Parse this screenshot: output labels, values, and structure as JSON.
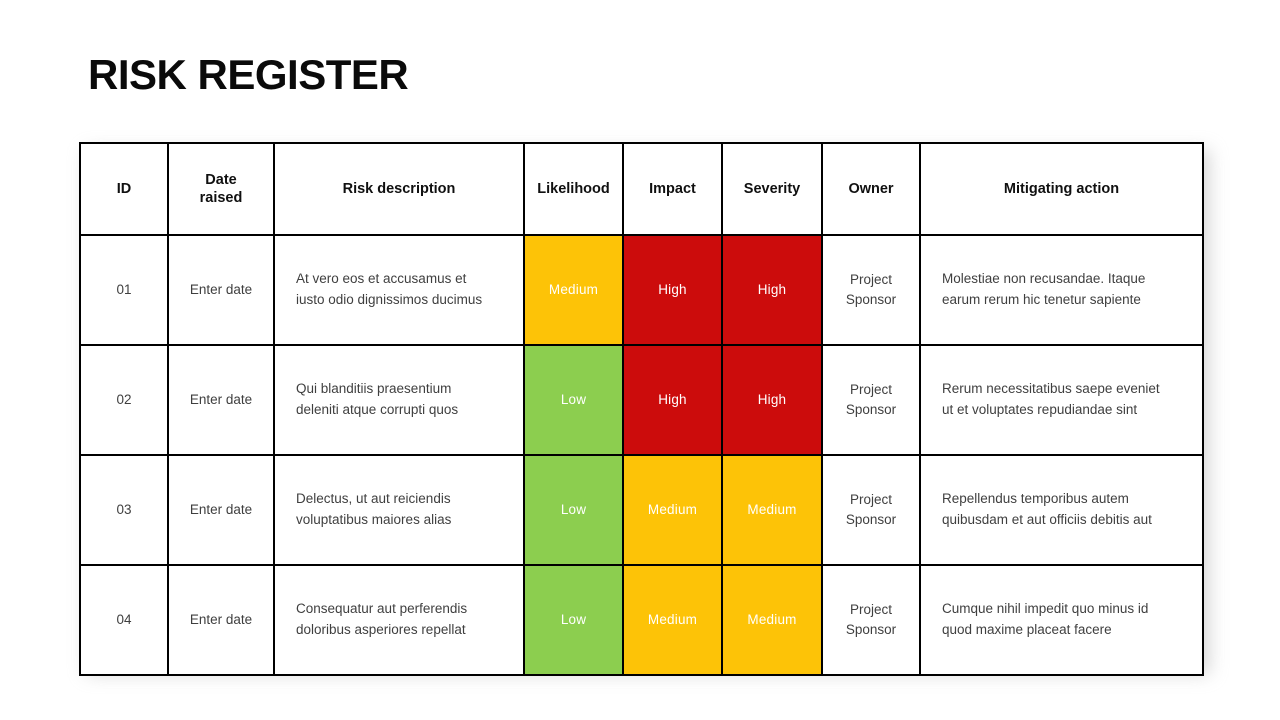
{
  "slide": {
    "title": "RISK REGISTER",
    "background_color": "#ffffff"
  },
  "colors": {
    "high": "#cc0c0c",
    "medium": "#fdc307",
    "low": "#8cce4f",
    "border": "#000000",
    "title_text": "#0a0a0a",
    "body_text": "#3f3f3f",
    "rating_text": "#ffffff"
  },
  "table": {
    "headers": [
      "ID",
      "Date\nraised",
      "Risk description",
      "Likelihood",
      "Impact",
      "Severity",
      "Owner",
      "Mitigating action"
    ],
    "header_labels": {
      "id": "ID",
      "date_raised_line1": "Date",
      "date_raised_line2": "raised",
      "risk_description": "Risk description",
      "likelihood": "Likelihood",
      "impact": "Impact",
      "severity": "Severity",
      "owner": "Owner",
      "mitigating_action": "Mitigating action"
    },
    "rows": [
      {
        "id": "01",
        "date_raised": "Enter date",
        "risk_description_line1": "At vero eos et accusamus et",
        "risk_description_line2": "iusto odio dignissimos ducimus",
        "likelihood": "Medium",
        "likelihood_level": "medium",
        "impact": "High",
        "impact_level": "high",
        "severity": "High",
        "severity_level": "high",
        "owner_line1": "Project",
        "owner_line2": "Sponsor",
        "mitigating_action_line1": "Molestiae non recusandae. Itaque",
        "mitigating_action_line2": "earum rerum hic tenetur sapiente"
      },
      {
        "id": "02",
        "date_raised": "Enter date",
        "risk_description_line1": "Qui blanditiis praesentium",
        "risk_description_line2": "deleniti atque corrupti quos",
        "likelihood": "Low",
        "likelihood_level": "low",
        "impact": "High",
        "impact_level": "high",
        "severity": "High",
        "severity_level": "high",
        "owner_line1": "Project",
        "owner_line2": "Sponsor",
        "mitigating_action_line1": "Rerum necessitatibus saepe eveniet",
        "mitigating_action_line2": "ut et voluptates repudiandae sint"
      },
      {
        "id": "03",
        "date_raised": "Enter date",
        "risk_description_line1": "Delectus, ut aut reiciendis",
        "risk_description_line2": "voluptatibus maiores alias",
        "likelihood": "Low",
        "likelihood_level": "low",
        "impact": "Medium",
        "impact_level": "medium",
        "severity": "Medium",
        "severity_level": "medium",
        "owner_line1": "Project",
        "owner_line2": "Sponsor",
        "mitigating_action_line1": "Repellendus temporibus autem",
        "mitigating_action_line2": "quibusdam et aut officiis debitis aut"
      },
      {
        "id": "04",
        "date_raised": "Enter date",
        "risk_description_line1": "Consequatur aut perferendis",
        "risk_description_line2": "doloribus asperiores repellat",
        "likelihood": "Low",
        "likelihood_level": "low",
        "impact": "Medium",
        "impact_level": "medium",
        "severity": "Medium",
        "severity_level": "medium",
        "owner_line1": "Project",
        "owner_line2": "Sponsor",
        "mitigating_action_line1": "Cumque nihil impedit quo minus id",
        "mitigating_action_line2": "quod maxime placeat facere"
      }
    ]
  }
}
